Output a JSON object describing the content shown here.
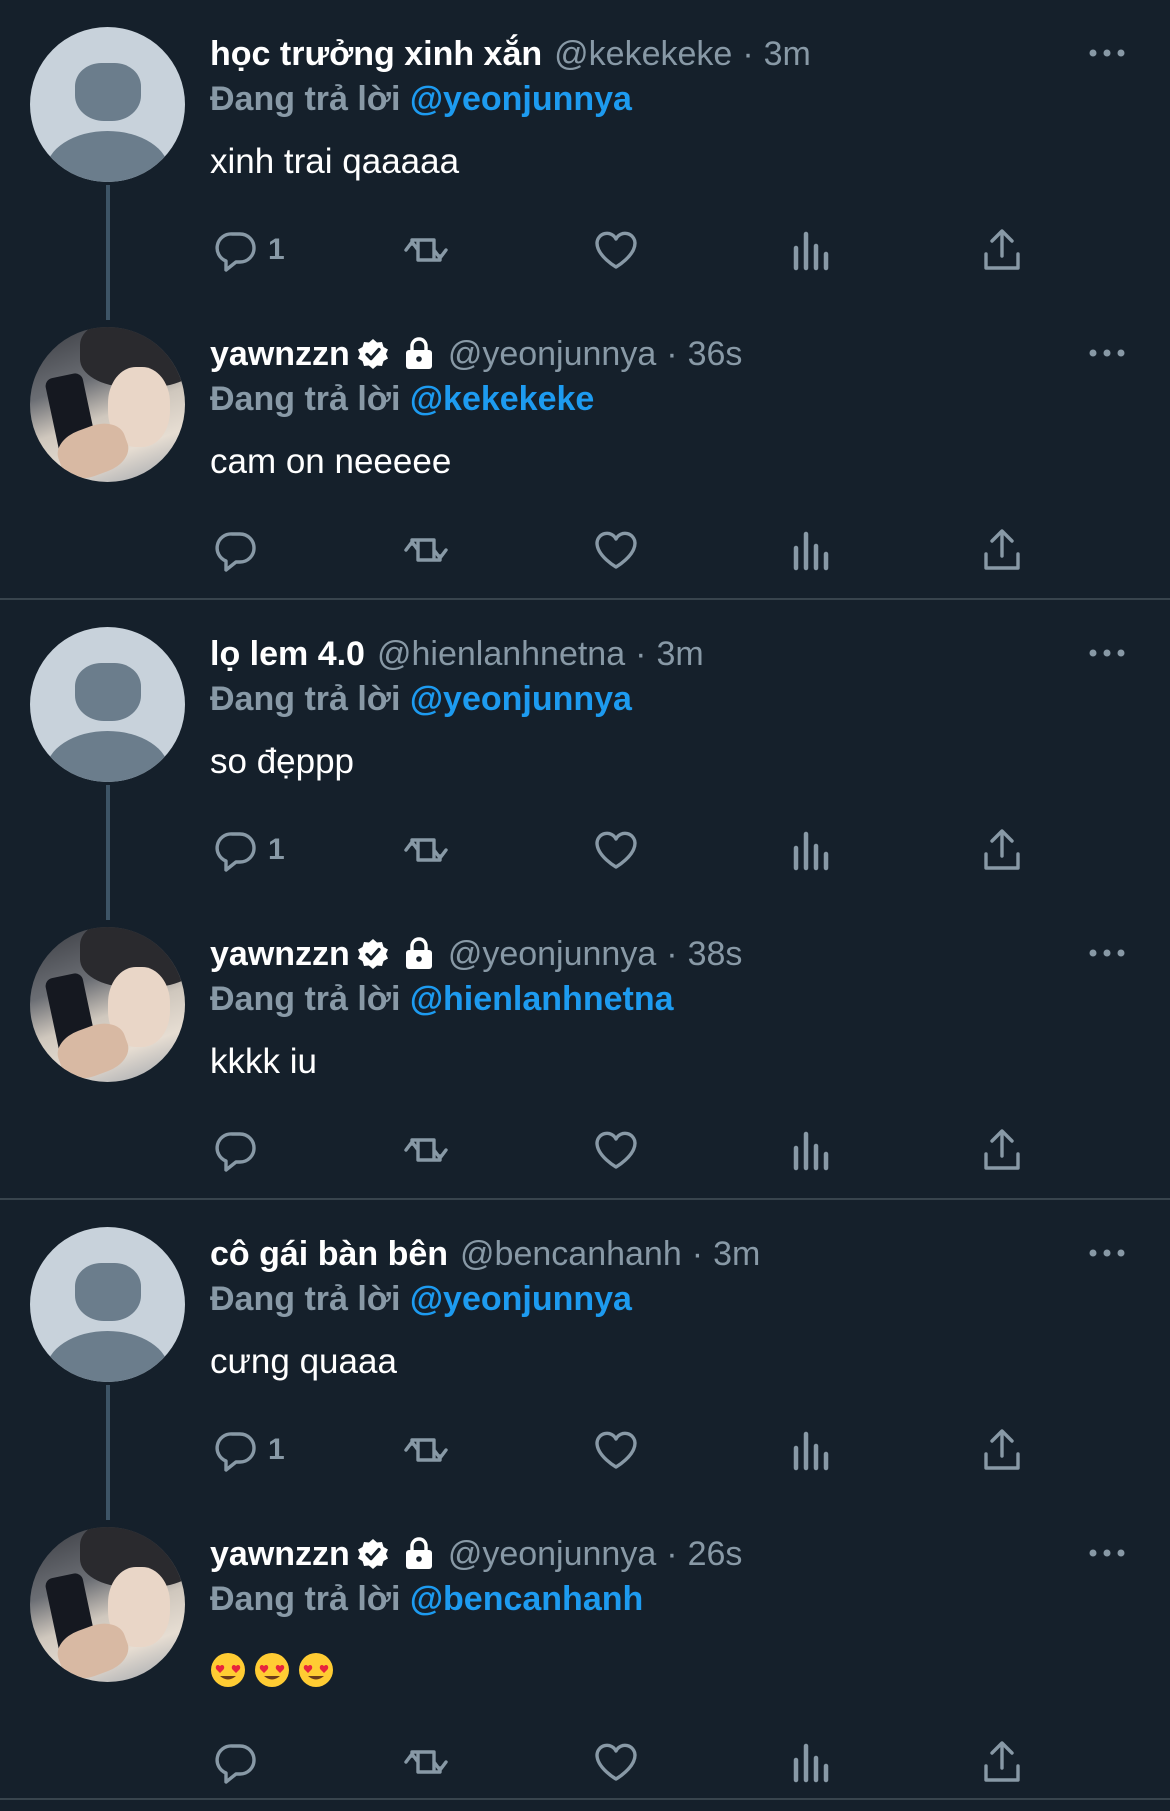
{
  "reply_prefix": "Đang trả lời",
  "threads": [
    {
      "top": {
        "name": "học trưởng xinh xắn",
        "handle": "@kekekeke",
        "dot": "·",
        "time": "3m",
        "reply_to": "@yeonjunnya",
        "text": "xinh trai qaaaaa",
        "reply_count": "1"
      },
      "bottom": {
        "name": "yawnzzn",
        "handle": "@yeonjunnya",
        "dot": "·",
        "time": "36s",
        "reply_to": "@kekekeke",
        "text": "cam on neeeee",
        "reply_count": ""
      }
    },
    {
      "top": {
        "name": "lọ lem 4.0",
        "handle": "@hienlanhnetna",
        "dot": "·",
        "time": "3m",
        "reply_to": "@yeonjunnya",
        "text": "so đẹppp",
        "reply_count": "1"
      },
      "bottom": {
        "name": "yawnzzn",
        "handle": "@yeonjunnya",
        "dot": "·",
        "time": "38s",
        "reply_to": "@hienlanhnetna",
        "text": "kkkk iu",
        "reply_count": ""
      }
    },
    {
      "top": {
        "name": "cô gái bàn bên",
        "handle": "@bencanhanh",
        "dot": "·",
        "time": "3m",
        "reply_to": "@yeonjunnya",
        "text": "cưng quaaa",
        "reply_count": "1"
      },
      "bottom": {
        "name": "yawnzzn",
        "handle": "@yeonjunnya",
        "dot": "·",
        "time": "26s",
        "reply_to": "@bencanhanh",
        "text": "",
        "emojis": [
          "heart-eyes-emoji",
          "heart-eyes-emoji",
          "heart-eyes-emoji"
        ],
        "reply_count": ""
      }
    }
  ],
  "colors": {
    "background": "#15202b",
    "muted": "#8899a6",
    "accent": "#1d9bf0",
    "divider": "#38444d"
  },
  "icons": [
    "reply-icon",
    "retweet-icon",
    "like-icon",
    "analytics-icon",
    "share-icon",
    "more-icon",
    "verified-badge-icon",
    "lock-icon"
  ]
}
